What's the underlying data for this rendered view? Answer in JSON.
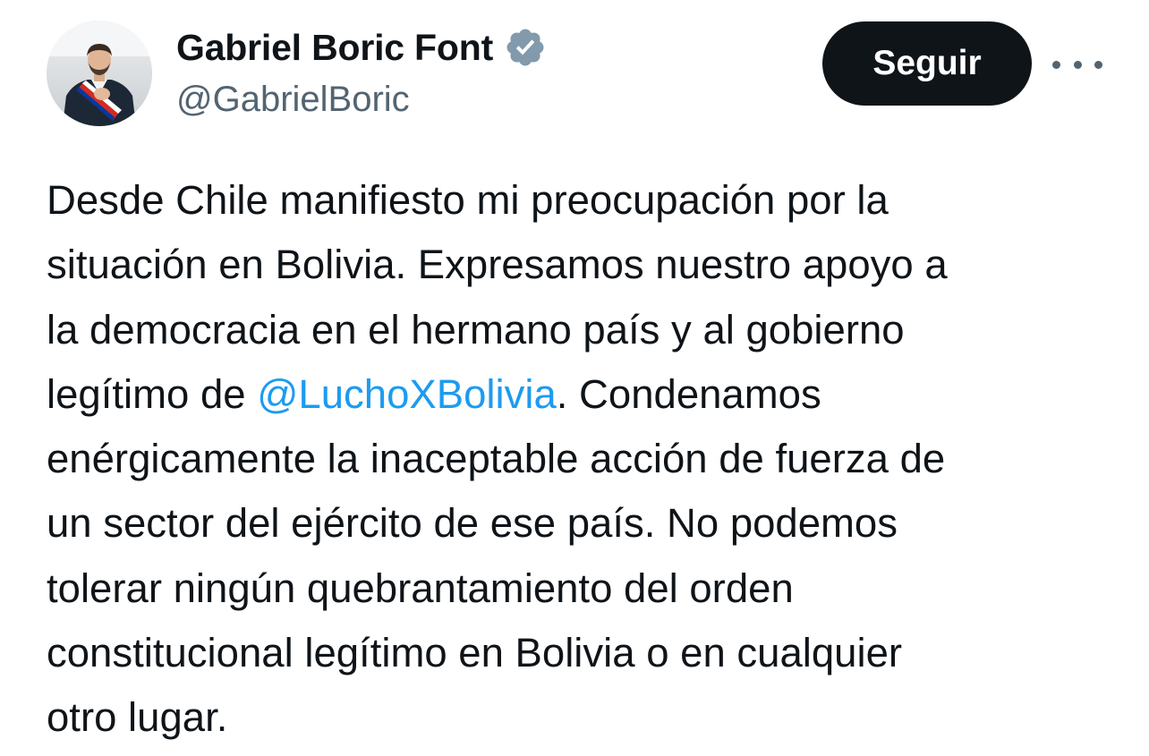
{
  "author": {
    "display_name": "Gabriel Boric Font",
    "handle": "@GabrielBoric",
    "verified_icon": "verified-badge-icon",
    "avatar_icon": "avatar"
  },
  "actions": {
    "follow_label": "Seguir",
    "more_icon": "more-icon"
  },
  "tweet": {
    "lines": [
      {
        "text": "Desde Chile manifiesto mi preocupación por la"
      },
      {
        "text": "situación en Bolivia. Expresamos nuestro apoyo a"
      },
      {
        "text": "la democracia en el hermano país y al gobierno"
      },
      {
        "before": "legítimo de ",
        "mention": "@LuchoXBolivia",
        "after": ". Condenamos"
      },
      {
        "text": "enérgicamente la inaceptable acción de fuerza de"
      },
      {
        "text": "un sector del ejército de ese país. No podemos"
      },
      {
        "text": "tolerar ningún quebrantamiento del orden"
      },
      {
        "text": "constitucional legítimo en Bolivia o en cualquier"
      },
      {
        "text": "otro lugar."
      }
    ]
  },
  "colors": {
    "text": "#0f1419",
    "secondary": "#536471",
    "mention": "#1d9bf0",
    "follow_bg": "#0f1419",
    "verified": "#829aab"
  }
}
